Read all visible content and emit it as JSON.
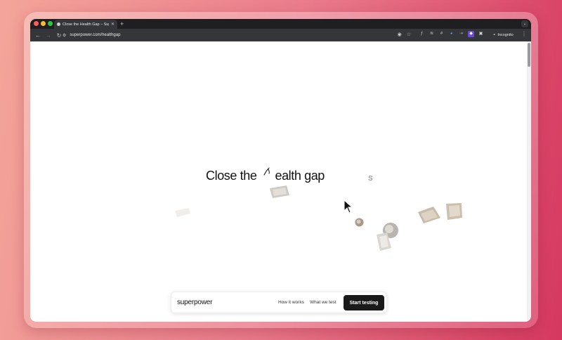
{
  "browser": {
    "tab_title": "Close the Health Gap – Superpower",
    "url": "superpower.com/healthgap",
    "profile_label": "Incognito"
  },
  "page": {
    "headline_part1": "Close the",
    "headline_part2": "ealth gap",
    "stray_letter": "S"
  },
  "navbar": {
    "brand": "superpower",
    "links": [
      "How it works",
      "What we test"
    ],
    "cta": "Start testing"
  },
  "colors": {
    "cta_bg": "#1a1a1a",
    "background_start": "#f4a59a",
    "background_end": "#d6385f"
  }
}
